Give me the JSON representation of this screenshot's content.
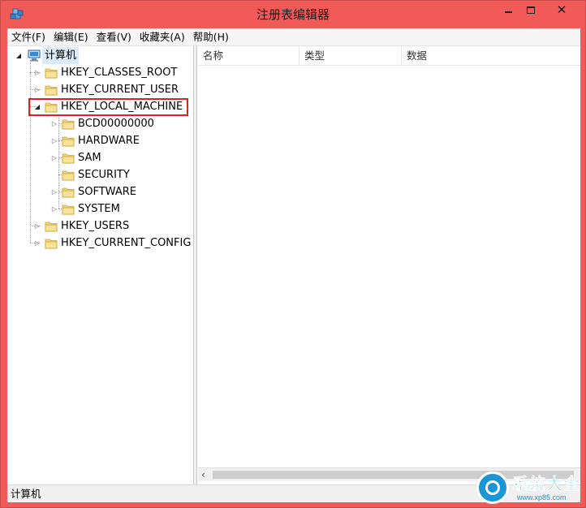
{
  "window": {
    "title": "注册表编辑器"
  },
  "titlebar_buttons": {
    "minimize": "",
    "maximize": "",
    "close": "✕"
  },
  "menu": [
    {
      "label": "文件(F)"
    },
    {
      "label": "编辑(E)"
    },
    {
      "label": "查看(V)"
    },
    {
      "label": "收藏夹(A)"
    },
    {
      "label": "帮助(H)"
    }
  ],
  "tree": {
    "root": "计算机",
    "hives": {
      "classes_root": "HKEY_CLASSES_ROOT",
      "current_user": "HKEY_CURRENT_USER",
      "local_machine": "HKEY_LOCAL_MACHINE",
      "users": "HKEY_USERS",
      "current_config": "HKEY_CURRENT_CONFIG"
    },
    "local_machine_children": {
      "bcd": "BCD00000000",
      "hardware": "HARDWARE",
      "sam": "SAM",
      "security": "SECURITY",
      "software": "SOFTWARE",
      "system": "SYSTEM"
    },
    "arrows": {
      "expanded": "◢",
      "collapsed": "▷"
    }
  },
  "list": {
    "columns": {
      "name": "名称",
      "type": "类型",
      "data": "数据"
    }
  },
  "scrollbar": {
    "left_arrow": "‹"
  },
  "status": {
    "path": "计算机"
  },
  "watermark": {
    "brand": "系统大全",
    "url": "www.xp85.com"
  },
  "colors": {
    "frame": "#f25a58",
    "highlight": "#e0221f",
    "watermark": "#1a96d4"
  }
}
